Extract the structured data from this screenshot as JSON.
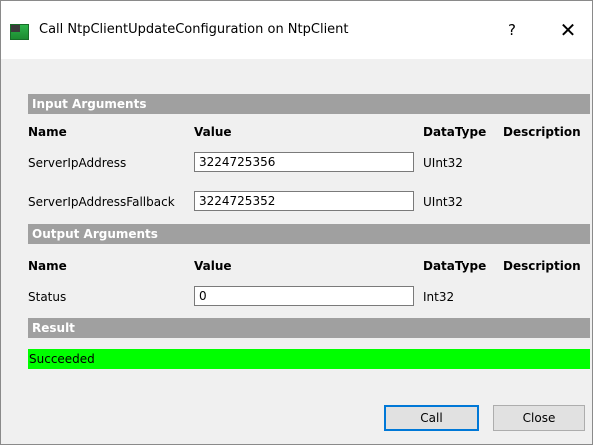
{
  "window": {
    "title": "Call NtpClientUpdateConfiguration on NtpClient",
    "help_glyph": "?",
    "close_glyph": "✕"
  },
  "input_section": {
    "title": "Input Arguments",
    "headers": {
      "name": "Name",
      "value": "Value",
      "datatype": "DataType",
      "description": "Description"
    },
    "rows": [
      {
        "name": "ServerIpAddress",
        "value": "3224725356",
        "datatype": "UInt32",
        "description": ""
      },
      {
        "name": "ServerIpAddressFallback",
        "value": "3224725352",
        "datatype": "UInt32",
        "description": ""
      }
    ]
  },
  "output_section": {
    "title": "Output Arguments",
    "headers": {
      "name": "Name",
      "value": "Value",
      "datatype": "DataType",
      "description": "Description"
    },
    "rows": [
      {
        "name": "Status",
        "value": "0",
        "datatype": "Int32",
        "description": ""
      }
    ]
  },
  "result_section": {
    "title": "Result",
    "status_text": "Succeeded",
    "status_color": "#00ff00"
  },
  "buttons": {
    "call_label": "Call",
    "close_label": "Close"
  }
}
